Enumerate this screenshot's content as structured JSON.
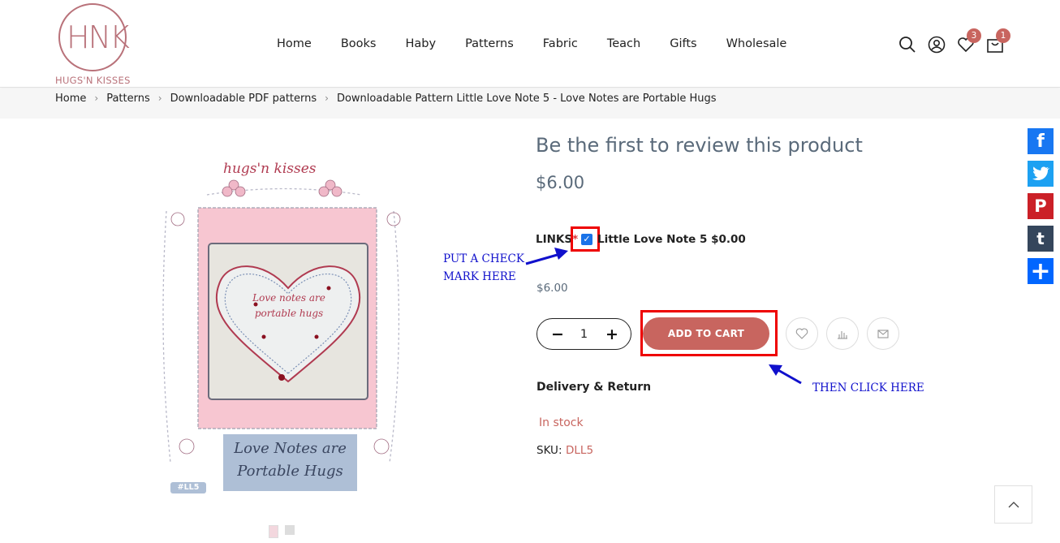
{
  "brand": {
    "name": "HUGS'N KISSES",
    "monogram": "HNK"
  },
  "nav": {
    "items": [
      {
        "label": "Home"
      },
      {
        "label": "Books"
      },
      {
        "label": "Haby"
      },
      {
        "label": "Patterns"
      },
      {
        "label": "Fabric"
      },
      {
        "label": "Teach"
      },
      {
        "label": "Gifts"
      },
      {
        "label": "Wholesale"
      }
    ]
  },
  "header_icons": {
    "search": "search-icon",
    "account": "user-icon",
    "wishlist": "heart-icon",
    "wishlist_count": "3",
    "cart": "bag-icon",
    "cart_count": "1"
  },
  "breadcrumb": {
    "items": [
      "Home",
      "Patterns",
      "Downloadable PDF patterns",
      "Downloadable Pattern Little Love Note 5 - Love Notes are Portable Hugs"
    ]
  },
  "product_image": {
    "brand_text": "hugs'n kisses",
    "heart_text": "Love notes are portable hugs",
    "caption_line1": "Love Notes are",
    "caption_line2": "Portable Hugs",
    "code": "#LL5"
  },
  "product": {
    "review_link": "Be the first to review this product",
    "price": "$6.00",
    "option_label": "LINKS",
    "required_mark": "*",
    "option_checked": true,
    "option_text": "Little Love Note 5 $0.00",
    "subtotal": "$6.00",
    "quantity": "1",
    "qty_minus": "−",
    "qty_plus": "+",
    "add_to_cart": "ADD TO CART",
    "delivery": "Delivery & Return",
    "stock": "In stock",
    "sku_label": "SKU:",
    "sku_value": "DLL5"
  },
  "annotations": {
    "check_line1": "PUT A CHECK",
    "check_line2": "MARK HERE",
    "click": "THEN CLICK HERE"
  },
  "social": [
    {
      "name": "facebook",
      "color": "#1877f2",
      "glyph": "f"
    },
    {
      "name": "twitter",
      "color": "#1da1f2",
      "glyph": "t"
    },
    {
      "name": "pinterest",
      "color": "#cb2027",
      "glyph": "P"
    },
    {
      "name": "tumblr",
      "color": "#35465c",
      "glyph": "t"
    },
    {
      "name": "share",
      "color": "#0166ff",
      "glyph": "+"
    }
  ],
  "colors": {
    "accent": "#c8655f",
    "annotation": "#1010cc",
    "highlight": "#e00000"
  }
}
